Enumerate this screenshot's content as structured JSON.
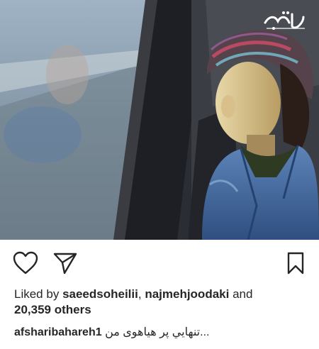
{
  "watermark": {
    "text": "برترین ها"
  },
  "post": {
    "liked_by_prefix": "Liked by",
    "liked_user_1": "saeedsoheilii",
    "separator": ",",
    "liked_user_2": "najmehjoodaki",
    "and_word": "and",
    "others_count_text": "20,359 others",
    "caption_username": "afsharibahareh1",
    "caption_text": "...تنهايي پر هياهوى من"
  },
  "icons": [
    "heart-icon",
    "share-icon",
    "bookmark-icon"
  ],
  "colors": {
    "text": "#262626",
    "icon_stroke": "#262626",
    "background": "#ffffff"
  }
}
